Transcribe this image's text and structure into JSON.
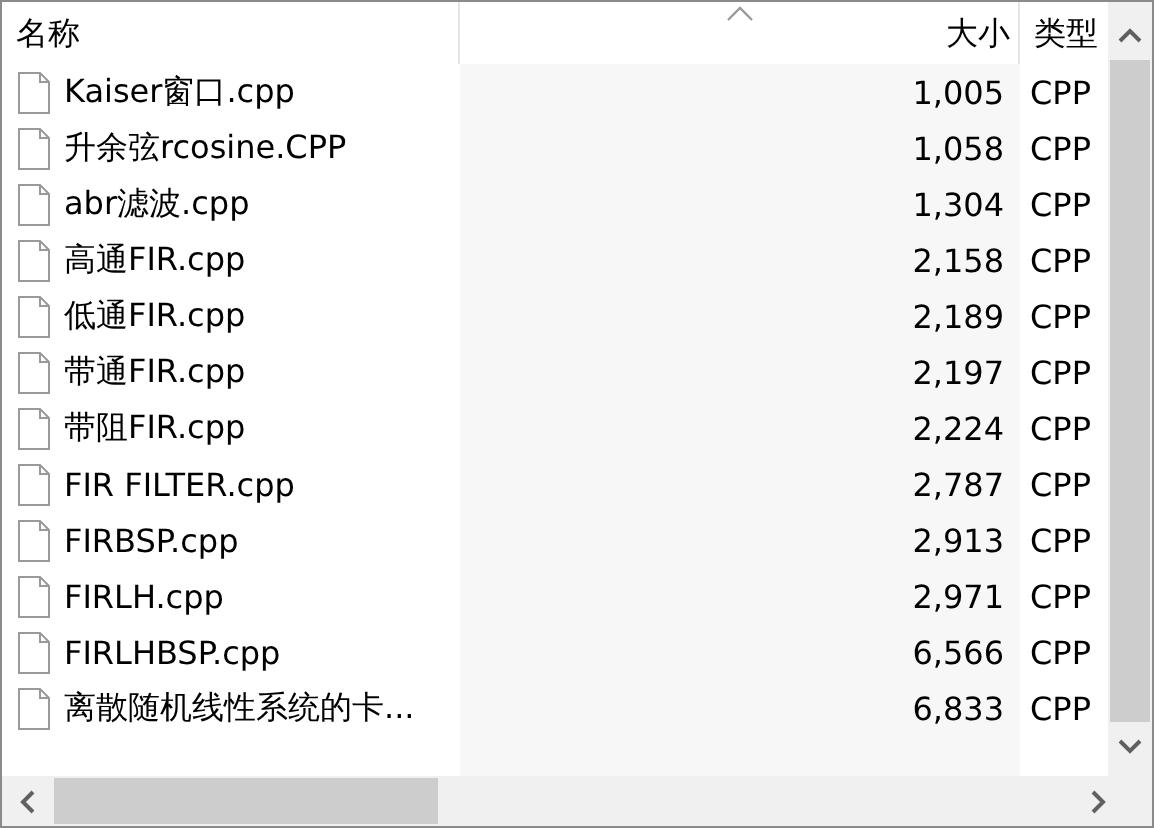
{
  "columns": [
    {
      "label": "名称",
      "kind": "name",
      "sorted": false
    },
    {
      "label": "大小",
      "kind": "size",
      "sorted": true
    },
    {
      "label": "类型",
      "kind": "type",
      "sorted": false
    }
  ],
  "files": [
    {
      "name": "Kaiser窗口.cpp",
      "size": "1,005",
      "type": "CPP"
    },
    {
      "name": "升余弦rcosine.CPP",
      "size": "1,058",
      "type": "CPP"
    },
    {
      "name": "abr滤波.cpp",
      "size": "1,304",
      "type": "CPP"
    },
    {
      "name": "高通FIR.cpp",
      "size": "2,158",
      "type": "CPP"
    },
    {
      "name": "低通FIR.cpp",
      "size": "2,189",
      "type": "CPP"
    },
    {
      "name": "带通FIR.cpp",
      "size": "2,197",
      "type": "CPP"
    },
    {
      "name": "带阻FIR.cpp",
      "size": "2,224",
      "type": "CPP"
    },
    {
      "name": "FIR FILTER.cpp",
      "size": "2,787",
      "type": "CPP"
    },
    {
      "name": "FIRBSP.cpp",
      "size": "2,913",
      "type": "CPP"
    },
    {
      "name": "FIRLH.cpp",
      "size": "2,971",
      "type": "CPP"
    },
    {
      "name": "FIRLHBSP.cpp",
      "size": "6,566",
      "type": "CPP"
    },
    {
      "name": "离散随机线性系统的卡...",
      "size": "6,833",
      "type": "CPP"
    }
  ]
}
